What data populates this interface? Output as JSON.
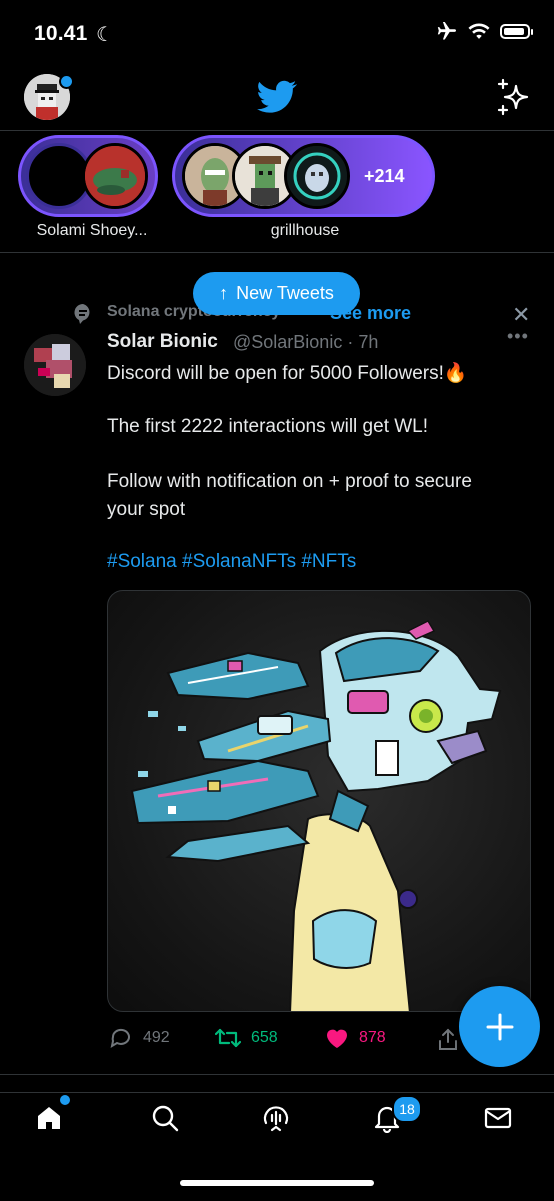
{
  "status_bar": {
    "time": "10.41"
  },
  "spaces": [
    {
      "label": "Solami Shoey..."
    },
    {
      "label": "grillhouse",
      "more_count": "+214"
    }
  ],
  "banner": {
    "new_tweets_label": "New Tweets"
  },
  "topic": {
    "name": "Solana cryptocurrency",
    "see_more": "See more"
  },
  "tweet": {
    "author_name": "Solar Bionic",
    "author_handle": "@SolarBionic · 7h",
    "lines": [
      "Discord will be open for 5000 Followers!🔥",
      "The first 2222 interactions will get WL!",
      "Follow with notification on + proof to secure",
      "your spot"
    ],
    "hashtags": "#Solana #SolanaNFTs #NFTs",
    "replies": "492",
    "retweets": "658",
    "likes": "878"
  },
  "nav": {
    "notifications_badge": "18"
  },
  "colors": {
    "accent": "#1d9bf0",
    "retweet": "#00ba7c",
    "like": "#f91880",
    "space": "#7c55ff"
  }
}
